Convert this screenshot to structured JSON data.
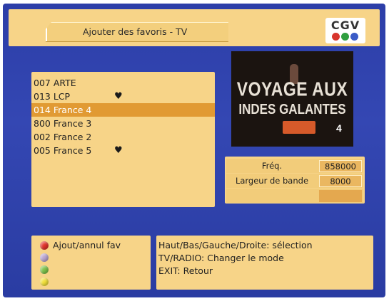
{
  "header": {
    "title": "Ajouter des favoris - TV",
    "logo": {
      "text": "CGV",
      "dot_colors": [
        "#d8352d",
        "#2f9f3f",
        "#3a5bc7"
      ]
    }
  },
  "channels": [
    {
      "label": "007 ARTE",
      "favorite": false,
      "selected": false
    },
    {
      "label": "013 LCP",
      "favorite": true,
      "selected": false
    },
    {
      "label": "014 France 4",
      "favorite": false,
      "selected": true
    },
    {
      "label": "800 France 3",
      "favorite": false,
      "selected": false
    },
    {
      "label": "002 France 2",
      "favorite": false,
      "selected": false
    },
    {
      "label": "005 France 5",
      "favorite": true,
      "selected": false
    }
  ],
  "preview": {
    "line1": "VOYAGE AUX",
    "line2": "INDES GALANTES",
    "channel_logo": "4"
  },
  "info": {
    "freq_label": "Fréq.",
    "freq_value": "858000",
    "bandwidth_label": "Largeur de bande",
    "bandwidth_value": "8000"
  },
  "legend": [
    {
      "color": "#e0322a",
      "label": "Ajout/annul fav"
    },
    {
      "color": "#b9a4cf",
      "label": ""
    },
    {
      "color": "#7cc24a",
      "label": ""
    },
    {
      "color": "#f2e03a",
      "label": ""
    }
  ],
  "help": {
    "line1": "Haut/Bas/Gauche/Droite: sélection",
    "line2": "TV/RADIO: Changer le mode",
    "line3": "EXIT: Retour"
  },
  "heart_glyph": "♥"
}
